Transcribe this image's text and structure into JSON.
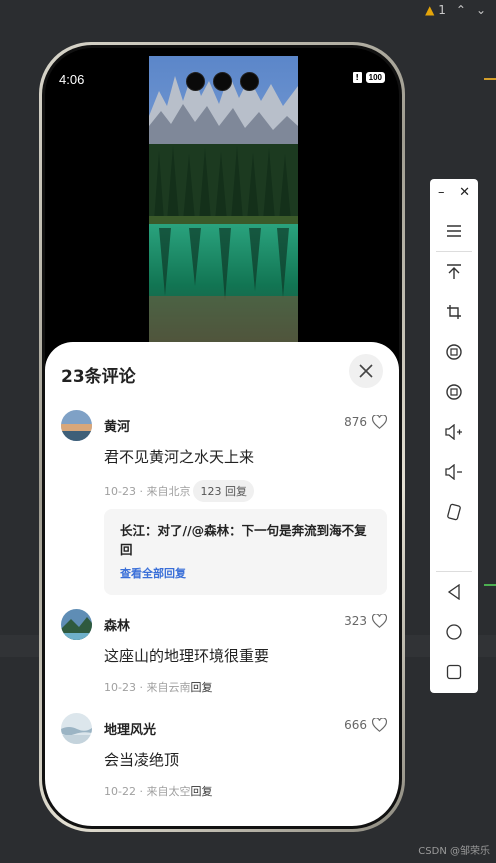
{
  "ide": {
    "warning_count": "1",
    "warning_icon": "warning-triangle-icon"
  },
  "status_bar": {
    "time": "4:06",
    "battery": "100"
  },
  "comments_panel": {
    "title": "23条评论",
    "comments": [
      {
        "name": "黄河",
        "likes": "876",
        "text": "君不见黄河之水天上来",
        "meta": "10-23 · 来自北京",
        "reply_label": "123 回复",
        "reply_preview": {
          "text": "长江：对了//@森林：下一句是奔流到海不复回",
          "view_all": "查看全部回复"
        }
      },
      {
        "name": "森林",
        "likes": "323",
        "text": "这座山的地理环境很重要",
        "meta": "10-23 · 来自云南",
        "reply_label": "回复"
      },
      {
        "name": "地理风光",
        "likes": "666",
        "text": "会当凌绝顶",
        "meta": "10-22 · 来自太空",
        "reply_label": "回复"
      }
    ]
  },
  "emulator_toolbar": {
    "items": [
      "menu-icon",
      "top-icon",
      "crop-icon",
      "rotate-left-icon",
      "rotate-right-icon",
      "volume-up-icon",
      "volume-down-icon",
      "fold-icon",
      "back-icon",
      "home-icon",
      "recent-icon"
    ]
  },
  "watermark": "CSDN @邹荣乐",
  "colors": {
    "link_blue": "#3a6fd8",
    "ide_bg": "#2b2d30"
  }
}
